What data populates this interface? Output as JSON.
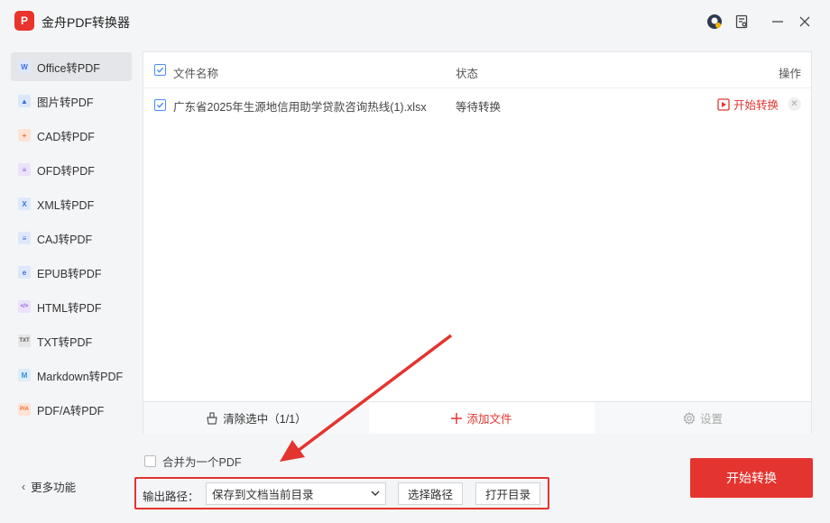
{
  "app": {
    "logo_text": "P",
    "title": "金舟PDF转换器"
  },
  "sidebar": {
    "items": [
      {
        "label": "Office转PDF",
        "icon": "word-icon",
        "glyph": "W",
        "color": "#3b6fe0",
        "bg": "#dfe8fb",
        "active": true
      },
      {
        "label": "图片转PDF",
        "icon": "image-icon",
        "glyph": "▲",
        "color": "#2f6fd8",
        "bg": "#dce7fa",
        "active": false
      },
      {
        "label": "CAD转PDF",
        "icon": "cad-icon",
        "glyph": "+",
        "color": "#f06b2b",
        "bg": "#fde4d6",
        "active": false
      },
      {
        "label": "OFD转PDF",
        "icon": "ofd-icon",
        "glyph": "≡",
        "color": "#8a5bd6",
        "bg": "#ebe2fa",
        "active": false
      },
      {
        "label": "XML转PDF",
        "icon": "xml-icon",
        "glyph": "X",
        "color": "#3b6fe0",
        "bg": "#dfe8fb",
        "active": false
      },
      {
        "label": "CAJ转PDF",
        "icon": "caj-icon",
        "glyph": "≡",
        "color": "#3b6fe0",
        "bg": "#dfe8fb",
        "active": false
      },
      {
        "label": "EPUB转PDF",
        "icon": "epub-icon",
        "glyph": "e",
        "color": "#3b6fe0",
        "bg": "#dfe8fb",
        "active": false
      },
      {
        "label": "HTML转PDF",
        "icon": "html-icon",
        "glyph": "</>",
        "color": "#8a5bd6",
        "bg": "#ebe2fa",
        "active": false
      },
      {
        "label": "TXT转PDF",
        "icon": "txt-icon",
        "glyph": "TXT",
        "color": "#555",
        "bg": "#e6e6e6",
        "active": false
      },
      {
        "label": "Markdown转PDF",
        "icon": "markdown-icon",
        "glyph": "M",
        "color": "#2f8fd8",
        "bg": "#dcedf9",
        "active": false
      },
      {
        "label": "PDF/A转PDF",
        "icon": "pdfa-icon",
        "glyph": "P/A",
        "color": "#f06b2b",
        "bg": "#fde4d6",
        "active": false
      }
    ],
    "more_label": "更多功能"
  },
  "table": {
    "headers": {
      "name": "文件名称",
      "status": "状态",
      "action": "操作"
    },
    "rows": [
      {
        "name": "广东省2025年生源地信用助学贷款咨询热线(1).xlsx",
        "status": "等待转换",
        "action": "开始转换",
        "checked": true
      }
    ]
  },
  "footer": {
    "clear": "清除选中（1/1）",
    "add": "添加文件",
    "settings": "设置"
  },
  "merge_label": "合并为一个PDF",
  "output": {
    "label": "输出路径：",
    "selected": "保存到文档当前目录",
    "choose": "选择路径",
    "open": "打开目录"
  },
  "start_button": "开始转换",
  "colors": {
    "accent": "#e3342f",
    "checkbox": "#4a8cff"
  }
}
